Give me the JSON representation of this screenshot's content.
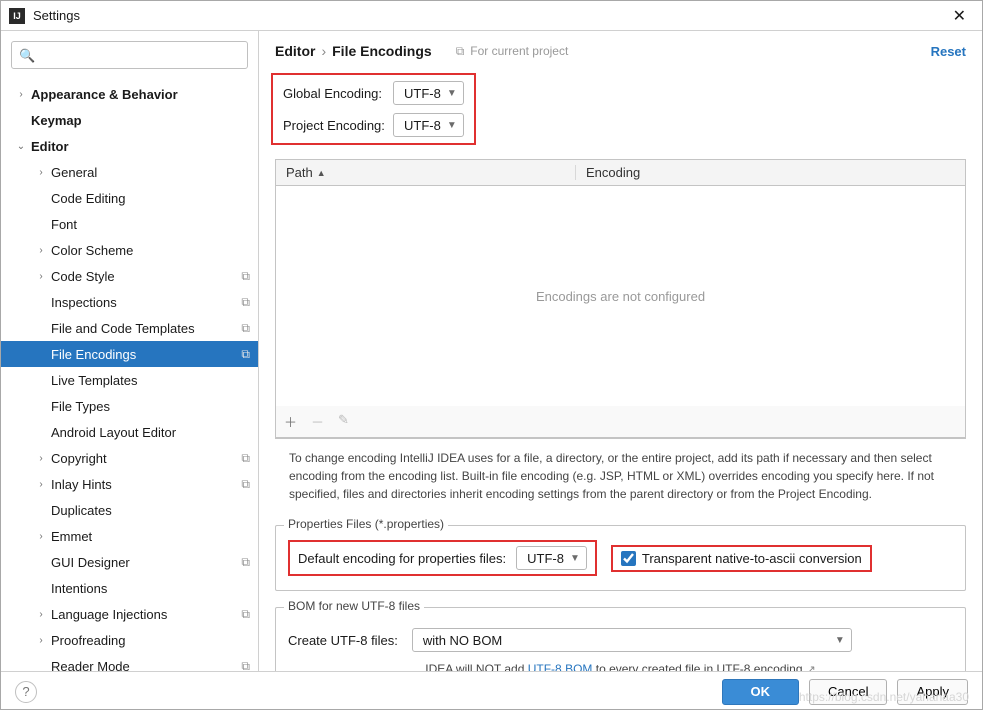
{
  "window": {
    "title": "Settings"
  },
  "search": {
    "placeholder": ""
  },
  "sidebar": {
    "items": [
      {
        "label": "Appearance & Behavior",
        "depth": 0,
        "chev": "right",
        "bold": true
      },
      {
        "label": "Keymap",
        "depth": 0,
        "bold": true
      },
      {
        "label": "Editor",
        "depth": 0,
        "chev": "down",
        "bold": true
      },
      {
        "label": "General",
        "depth": 1,
        "chev": "right"
      },
      {
        "label": "Code Editing",
        "depth": 1
      },
      {
        "label": "Font",
        "depth": 1
      },
      {
        "label": "Color Scheme",
        "depth": 1,
        "chev": "right"
      },
      {
        "label": "Code Style",
        "depth": 1,
        "chev": "right",
        "proj": true
      },
      {
        "label": "Inspections",
        "depth": 1,
        "proj": true
      },
      {
        "label": "File and Code Templates",
        "depth": 1,
        "proj": true
      },
      {
        "label": "File Encodings",
        "depth": 1,
        "proj": true,
        "selected": true
      },
      {
        "label": "Live Templates",
        "depth": 1
      },
      {
        "label": "File Types",
        "depth": 1
      },
      {
        "label": "Android Layout Editor",
        "depth": 1
      },
      {
        "label": "Copyright",
        "depth": 1,
        "chev": "right",
        "proj": true
      },
      {
        "label": "Inlay Hints",
        "depth": 1,
        "chev": "right",
        "proj": true
      },
      {
        "label": "Duplicates",
        "depth": 1
      },
      {
        "label": "Emmet",
        "depth": 1,
        "chev": "right"
      },
      {
        "label": "GUI Designer",
        "depth": 1,
        "proj": true
      },
      {
        "label": "Intentions",
        "depth": 1
      },
      {
        "label": "Language Injections",
        "depth": 1,
        "chev": "right",
        "proj": true
      },
      {
        "label": "Proofreading",
        "depth": 1,
        "chev": "right"
      },
      {
        "label": "Reader Mode",
        "depth": 1,
        "proj": true
      }
    ]
  },
  "breadcrumb": {
    "root": "Editor",
    "leaf": "File Encodings",
    "hint": "For current project",
    "reset": "Reset"
  },
  "globalEncoding": {
    "label": "Global Encoding:",
    "value": "UTF-8"
  },
  "projectEncoding": {
    "label": "Project Encoding:",
    "value": "UTF-8"
  },
  "table": {
    "col_path": "Path",
    "col_enc": "Encoding",
    "empty": "Encodings are not configured"
  },
  "hint": "To change encoding IntelliJ IDEA uses for a file, a directory, or the entire project, add its path if necessary and then select encoding from the encoding list. Built-in file encoding (e.g. JSP, HTML or XML) overrides encoding you specify here. If not specified, files and directories inherit encoding settings from the parent directory or from the Project Encoding.",
  "props": {
    "legend": "Properties Files (*.properties)",
    "default_label": "Default encoding for properties files:",
    "default_value": "UTF-8",
    "transparent_label": "Transparent native-to-ascii conversion"
  },
  "bom": {
    "legend": "BOM for new UTF-8 files",
    "create_label": "Create UTF-8 files:",
    "create_value": "with NO BOM",
    "note_pre": "IDEA will NOT add ",
    "note_link": "UTF-8 BOM",
    "note_post": " to every created file in UTF-8 encoding"
  },
  "buttons": {
    "ok": "OK",
    "cancel": "Cancel",
    "apply": "Apply"
  },
  "watermark": "https://blog.csdn.net/yahahaa30"
}
